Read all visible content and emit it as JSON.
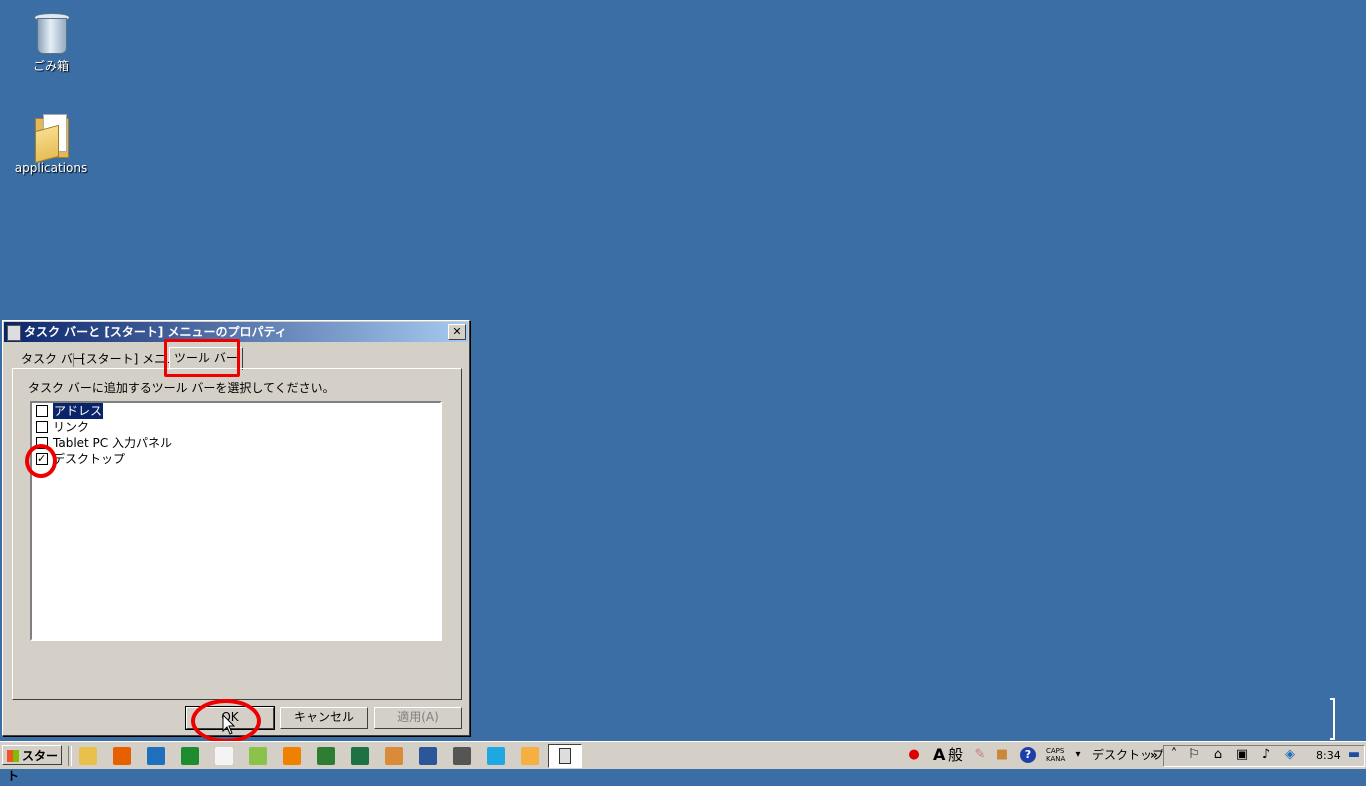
{
  "desktop": {
    "icons": [
      {
        "label": "ごみ箱",
        "icon": "recycle-bin-icon"
      },
      {
        "label": "applications",
        "icon": "folder-icon"
      }
    ]
  },
  "dialog": {
    "title": "タスク バーと [スタート] メニューのプロパティ",
    "close_glyph": "✕",
    "tabs": [
      "タスク バー",
      "[スタート] メニュー",
      "ツール バー"
    ],
    "active_tab": "ツール バー",
    "instruction": "タスク バーに追加するツール バーを選択してください。",
    "toolbars": [
      {
        "label": "アドレス",
        "checked": false,
        "selected": true
      },
      {
        "label": "リンク",
        "checked": false,
        "selected": false
      },
      {
        "label": "Tablet PC 入力パネル",
        "checked": false,
        "selected": false
      },
      {
        "label": "デスクトップ",
        "checked": true,
        "selected": false
      }
    ],
    "buttons": {
      "ok": "OK",
      "cancel": "キャンセル",
      "apply": "適用(A)"
    }
  },
  "taskbar": {
    "start_label": "スタート",
    "quick_launch": [
      {
        "icon": "explorer-icon",
        "color": "#e8c04a"
      },
      {
        "icon": "firefox-icon",
        "color": "#e66000"
      },
      {
        "icon": "thunderbird-icon",
        "color": "#1f6fbf"
      },
      {
        "icon": "green-app-icon",
        "color": "#1c8c2e"
      },
      {
        "icon": "notepad-icon",
        "color": "#f4f4f4"
      },
      {
        "icon": "calc-icon",
        "color": "#8bc34a"
      },
      {
        "icon": "vlc-icon",
        "color": "#f08000"
      },
      {
        "icon": "network-icon",
        "color": "#2e7d32"
      },
      {
        "icon": "excel-icon",
        "color": "#1e7145"
      },
      {
        "icon": "package-icon",
        "color": "#d98b3a"
      },
      {
        "icon": "word-icon",
        "color": "#2b579a"
      },
      {
        "icon": "virtualbox-icon",
        "color": "#555555"
      },
      {
        "icon": "media-icon",
        "color": "#1ea7e1"
      },
      {
        "icon": "paint-icon",
        "color": "#f5b041"
      }
    ],
    "toolbar_label": "デスクトップ",
    "chevron": "»",
    "ime_mode": "A",
    "ime_label": "般",
    "caps_top": "CAPS",
    "caps_bottom": "KANA",
    "clock": "8:34"
  }
}
